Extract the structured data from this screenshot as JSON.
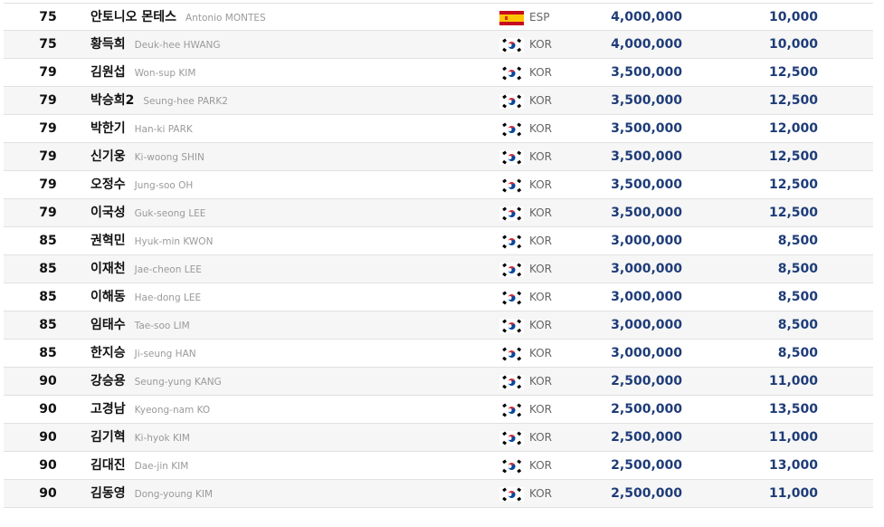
{
  "flag_colors": {
    "ESP": {
      "red": "#c60b1e",
      "yellow": "#ffc400"
    },
    "KOR": {
      "white": "#ffffff",
      "red": "#cd2e3a",
      "blue": "#0047a0",
      "black": "#000000"
    }
  },
  "value_color": "#1e3c78",
  "rows": [
    {
      "rank": "75",
      "name_ko": "안토니오 몬테스",
      "name_en": "Antonio MONTES",
      "flag": "spain-flag-icon",
      "country": "ESP",
      "prize": "4,000,000",
      "points": "10,000"
    },
    {
      "rank": "75",
      "name_ko": "황득희",
      "name_en": "Deuk-hee HWANG",
      "flag": "korea-flag-icon",
      "country": "KOR",
      "prize": "4,000,000",
      "points": "10,000"
    },
    {
      "rank": "79",
      "name_ko": "김원섭",
      "name_en": "Won-sup KIM",
      "flag": "korea-flag-icon",
      "country": "KOR",
      "prize": "3,500,000",
      "points": "12,500"
    },
    {
      "rank": "79",
      "name_ko": "박승희2",
      "name_en": "Seung-hee PARK2",
      "flag": "korea-flag-icon",
      "country": "KOR",
      "prize": "3,500,000",
      "points": "12,500"
    },
    {
      "rank": "79",
      "name_ko": "박한기",
      "name_en": "Han-ki PARK",
      "flag": "korea-flag-icon",
      "country": "KOR",
      "prize": "3,500,000",
      "points": "12,000"
    },
    {
      "rank": "79",
      "name_ko": "신기웅",
      "name_en": "Ki-woong SHIN",
      "flag": "korea-flag-icon",
      "country": "KOR",
      "prize": "3,500,000",
      "points": "12,500"
    },
    {
      "rank": "79",
      "name_ko": "오정수",
      "name_en": "Jung-soo OH",
      "flag": "korea-flag-icon",
      "country": "KOR",
      "prize": "3,500,000",
      "points": "12,500"
    },
    {
      "rank": "79",
      "name_ko": "이국성",
      "name_en": "Guk-seong LEE",
      "flag": "korea-flag-icon",
      "country": "KOR",
      "prize": "3,500,000",
      "points": "12,500"
    },
    {
      "rank": "85",
      "name_ko": "권혁민",
      "name_en": "Hyuk-min KWON",
      "flag": "korea-flag-icon",
      "country": "KOR",
      "prize": "3,000,000",
      "points": "8,500"
    },
    {
      "rank": "85",
      "name_ko": "이재천",
      "name_en": "Jae-cheon LEE",
      "flag": "korea-flag-icon",
      "country": "KOR",
      "prize": "3,000,000",
      "points": "8,500"
    },
    {
      "rank": "85",
      "name_ko": "이해동",
      "name_en": "Hae-dong LEE",
      "flag": "korea-flag-icon",
      "country": "KOR",
      "prize": "3,000,000",
      "points": "8,500"
    },
    {
      "rank": "85",
      "name_ko": "임태수",
      "name_en": "Tae-soo LIM",
      "flag": "korea-flag-icon",
      "country": "KOR",
      "prize": "3,000,000",
      "points": "8,500"
    },
    {
      "rank": "85",
      "name_ko": "한지승",
      "name_en": "Ji-seung HAN",
      "flag": "korea-flag-icon",
      "country": "KOR",
      "prize": "3,000,000",
      "points": "8,500"
    },
    {
      "rank": "90",
      "name_ko": "강승용",
      "name_en": "Seung-yung KANG",
      "flag": "korea-flag-icon",
      "country": "KOR",
      "prize": "2,500,000",
      "points": "11,000"
    },
    {
      "rank": "90",
      "name_ko": "고경남",
      "name_en": "Kyeong-nam KO",
      "flag": "korea-flag-icon",
      "country": "KOR",
      "prize": "2,500,000",
      "points": "13,500"
    },
    {
      "rank": "90",
      "name_ko": "김기혁",
      "name_en": "Ki-hyok KIM",
      "flag": "korea-flag-icon",
      "country": "KOR",
      "prize": "2,500,000",
      "points": "11,000"
    },
    {
      "rank": "90",
      "name_ko": "김대진",
      "name_en": "Dae-jin KIM",
      "flag": "korea-flag-icon",
      "country": "KOR",
      "prize": "2,500,000",
      "points": "13,000"
    },
    {
      "rank": "90",
      "name_ko": "김동영",
      "name_en": "Dong-young KIM",
      "flag": "korea-flag-icon",
      "country": "KOR",
      "prize": "2,500,000",
      "points": "11,000"
    }
  ]
}
